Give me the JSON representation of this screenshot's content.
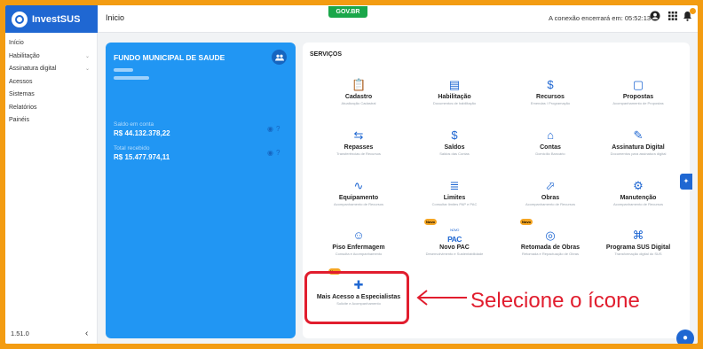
{
  "app": {
    "name": "InvestSUS"
  },
  "header": {
    "page_title": "Inicio",
    "gov_badge": "GOV.BR",
    "session_text": "A conexão encerrará em: 05:52:13",
    "icons": [
      "user-icon",
      "apps-grid-icon",
      "notifications-bell-icon"
    ]
  },
  "sidebar": {
    "items": [
      {
        "label": "Início",
        "expandable": false
      },
      {
        "label": "Habilitação",
        "expandable": true
      },
      {
        "label": "Assinatura digital",
        "expandable": true
      },
      {
        "label": "Acessos",
        "expandable": false
      },
      {
        "label": "Sistemas",
        "expandable": false
      },
      {
        "label": "Relatórios",
        "expandable": false
      },
      {
        "label": "Painéis",
        "expandable": false
      }
    ],
    "version": "1.51.0",
    "collapse_symbol": "‹"
  },
  "entity_card": {
    "title": "FUNDO MUNICIPAL DE SAUDE",
    "saldo_label": "Saldo em conta",
    "saldo_value": "R$ 44.132.378,22",
    "total_label": "Total recebido",
    "total_value": "R$ 15.477.974,11"
  },
  "services": {
    "title": "SERVIÇOS",
    "items": [
      {
        "name": "Cadastro",
        "desc": "Atualização Cadastral",
        "icon": "clipboard-icon",
        "badge": ""
      },
      {
        "name": "Habilitação",
        "desc": "Documentos de habilitação",
        "icon": "document-icon",
        "badge": ""
      },
      {
        "name": "Recursos",
        "desc": "Emendas / Programação",
        "icon": "money-bag-icon",
        "badge": ""
      },
      {
        "name": "Propostas",
        "desc": "Acompanhamento de Propostas",
        "icon": "proposal-icon",
        "badge": ""
      },
      {
        "name": "Repasses",
        "desc": "Transferências de Recursos",
        "icon": "transfer-arrows-icon",
        "badge": ""
      },
      {
        "name": "Saldos",
        "desc": "Saldos das Contas",
        "icon": "coin-icon",
        "badge": ""
      },
      {
        "name": "Contas",
        "desc": "Domicílio Bancário",
        "icon": "bank-house-icon",
        "badge": ""
      },
      {
        "name": "Assinatura Digital",
        "desc": "Documentos para assinatura digital",
        "icon": "signature-icon",
        "badge": ""
      },
      {
        "name": "Equipamento",
        "desc": "Acompanhamento de Recursos",
        "icon": "stethoscope-icon",
        "badge": ""
      },
      {
        "name": "Limites",
        "desc": "Consultar limites PAP e PAC",
        "icon": "limits-chart-icon",
        "badge": ""
      },
      {
        "name": "Obras",
        "desc": "Acompanhamento de Recursos",
        "icon": "trowel-icon",
        "badge": ""
      },
      {
        "name": "Manutenção",
        "desc": "Acompanhamento de Recursos",
        "icon": "gear-wrench-icon",
        "badge": ""
      },
      {
        "name": "Piso Enfermagem",
        "desc": "Consulta e Acompanhamento",
        "icon": "nurses-group-icon",
        "badge": ""
      },
      {
        "name": "Novo PAC",
        "desc": "Desenvolvimento e Sustentabilidade",
        "icon": "novo-pac-logo-icon",
        "badge": "Novo"
      },
      {
        "name": "Retomada de Obras",
        "desc": "Retomada e Repactuação de Obras",
        "icon": "construction-restart-icon",
        "badge": "Novo"
      },
      {
        "name": "Programa SUS Digital",
        "desc": "Transformação digital do SUS",
        "icon": "digital-network-icon",
        "badge": ""
      },
      {
        "name": "Mais Acesso a Especialistas",
        "desc": "Solicite e Acompanhamento",
        "icon": "specialist-stethoscope-icon",
        "badge": "Novo"
      }
    ]
  },
  "annotation": {
    "text": "Selecione o ícone",
    "color": "#e11d2e"
  },
  "colors": {
    "brand": "#1f67d2",
    "card": "#2196f3",
    "frame": "#f39c12",
    "badge": "#f5a623"
  }
}
